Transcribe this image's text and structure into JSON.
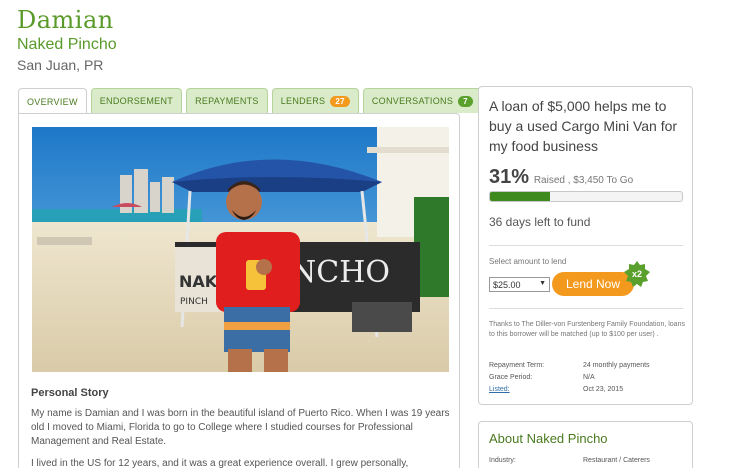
{
  "header": {
    "borrower_name": "Damian",
    "business_name": "Naked Pincho",
    "location": "San Juan, PR"
  },
  "tabs": [
    {
      "label": "OVERVIEW",
      "active": true
    },
    {
      "label": "ENDORSEMENT"
    },
    {
      "label": "REPAYMENTS"
    },
    {
      "label": "LENDERS",
      "badge": "27"
    },
    {
      "label": "CONVERSATIONS",
      "badge": "7"
    }
  ],
  "story": {
    "title": "Personal Story",
    "paragraph_1": "My name is Damian and I was born in the beautiful island of Puerto Rico. When I was 19 years old I moved to Miami, Florida to go to College where I studied courses for Professional Management and Real Estate.",
    "paragraph_2": "I lived in the US for 12 years, and it was a great experience overall. I grew personally,"
  },
  "photo": {
    "tent_sign_left": "NAK",
    "tent_sign_left_2": "PINCH",
    "tent_sign_right": "NCHO"
  },
  "loan": {
    "title": "A loan of $5,000 helps me to buy a used Cargo Mini Van for my food business",
    "percent": "31%",
    "percent_fraction": 0.31,
    "raised_text": "Raised , $3,450 To Go",
    "days_left": "36 days left to fund",
    "select_label": "Select amount to lend",
    "selected_amount": "$25.00",
    "lend_button": "Lend Now",
    "match_badge": "x2",
    "match_note": "Thanks to The Diller-von Furstenberg Family Foundation, loans to this borrower will be matched (up to $100 per user) .",
    "terms": [
      {
        "label": "Repayment Term:",
        "value": "24 monthly payments"
      },
      {
        "label": "Grace Period:",
        "value": "N/A"
      },
      {
        "label": "Listed:",
        "value": "Oct 23, 2015"
      }
    ]
  },
  "about": {
    "title": "About Naked Pincho",
    "industry_label": "Industry:",
    "industry_value": "Restaurant / Caterers"
  },
  "colors": {
    "brand_green": "#5a9a2a",
    "progress_green": "#3f8a1f",
    "lend_orange": "#f39a1e",
    "tab_bg": "#d9ebc8"
  },
  "icons": [
    "match-x2-badge-icon",
    "select-caret-icon"
  ]
}
